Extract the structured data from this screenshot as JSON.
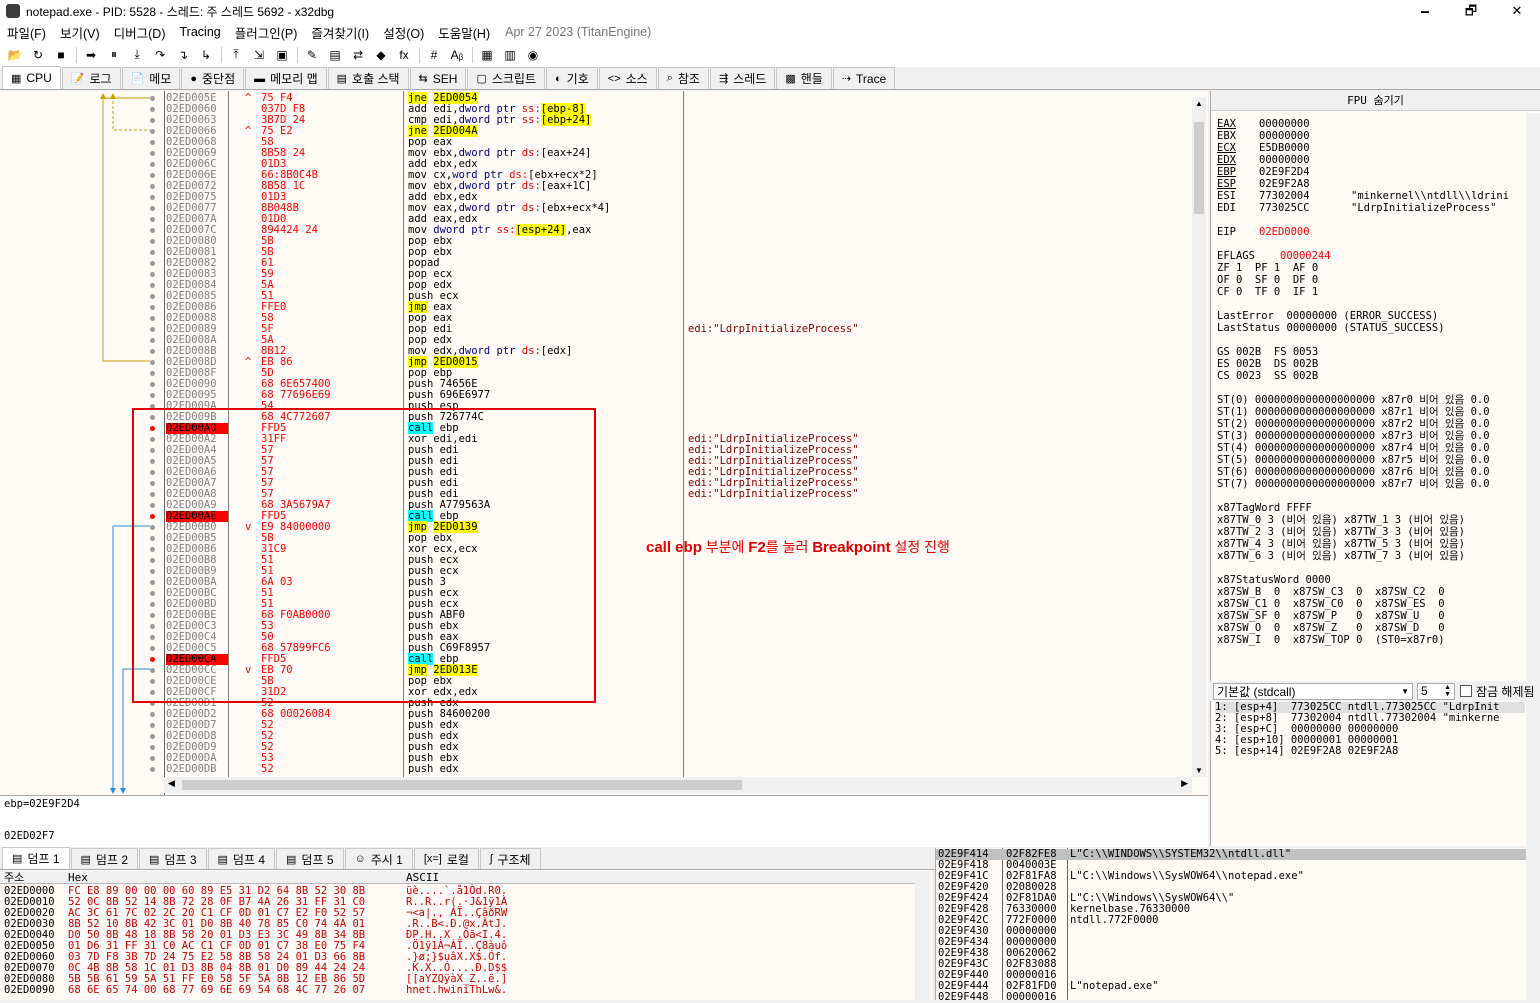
{
  "window": {
    "title": "notepad.exe - PID: 5528 - 스레드: 주 스레드 5692 - x32dbg",
    "minimize": "🗕",
    "maximize": "🗗",
    "close": "✕"
  },
  "menu": {
    "items": [
      "파일(F)",
      "보기(V)",
      "디버그(D)",
      "Tracing",
      "플러그인(P)",
      "즐겨찾기(I)",
      "설정(O)",
      "도움말(H)"
    ],
    "date": "Apr 27 2023 (TitanEngine)"
  },
  "toolbar": {
    "icons": [
      "📂",
      "↻",
      "■",
      "➡",
      "⏸",
      "⤓",
      "↷",
      "↴",
      "↳",
      "⤒",
      "⇲",
      "▣",
      "✎",
      "▤",
      "⇄",
      "◆",
      "fx",
      "#",
      "Aᵦ",
      "▦",
      "▥",
      "◉"
    ]
  },
  "tabs": [
    {
      "icon": "▦",
      "label": "CPU"
    },
    {
      "icon": "📝",
      "label": "로그"
    },
    {
      "icon": "📄",
      "label": "메모"
    },
    {
      "icon": "●",
      "label": "중단점"
    },
    {
      "icon": "▬",
      "label": "메모리 맵"
    },
    {
      "icon": "▤",
      "label": "호출 스택"
    },
    {
      "icon": "⇆",
      "label": "SEH"
    },
    {
      "icon": "▢",
      "label": "스크립트"
    },
    {
      "icon": "◐",
      "label": "기호"
    },
    {
      "icon": "<>",
      "label": "소스"
    },
    {
      "icon": "⌕",
      "label": "참조"
    },
    {
      "icon": "⇶",
      "label": "스레드"
    },
    {
      "icon": "▩",
      "label": "핸들"
    },
    {
      "icon": "⇢",
      "label": "Trace"
    }
  ],
  "disasm": {
    "rows": [
      {
        "a": "02ED005E",
        "j": "^",
        "b": "75 F4",
        "i": [
          {
            "t": "jne",
            "c": "hl-y"
          },
          {
            "t": " "
          },
          {
            "t": "2ED0054",
            "c": "hl-y"
          }
        ]
      },
      {
        "a": "02ED0060",
        "b": "037D F8",
        "i": [
          {
            "t": "add edi,"
          },
          {
            "t": "dword ptr ",
            "c": "ptr"
          },
          {
            "t": "ss:",
            "c": "seg"
          },
          {
            "t": "[ebp-8]",
            "c": "hl-y"
          }
        ]
      },
      {
        "a": "02ED0063",
        "b": "3B7D 24",
        "i": [
          {
            "t": "cmp edi,"
          },
          {
            "t": "dword ptr ",
            "c": "ptr"
          },
          {
            "t": "ss:",
            "c": "seg"
          },
          {
            "t": "[ebp+24]",
            "c": "hl-y"
          }
        ]
      },
      {
        "a": "02ED0066",
        "j": "^",
        "b": "75 E2",
        "i": [
          {
            "t": "jne",
            "c": "hl-y"
          },
          {
            "t": " "
          },
          {
            "t": "2ED004A",
            "c": "hl-y"
          }
        ]
      },
      {
        "a": "02ED0068",
        "b": "58",
        "i": [
          {
            "t": "pop eax"
          }
        ]
      },
      {
        "a": "02ED0069",
        "b": "8B58 24",
        "i": [
          {
            "t": "mov ebx,"
          },
          {
            "t": "dword ptr ",
            "c": "ptr"
          },
          {
            "t": "ds:",
            "c": "seg"
          },
          {
            "t": "[eax+24]"
          }
        ]
      },
      {
        "a": "02ED006C",
        "b": "01D3",
        "i": [
          {
            "t": "add ebx,edx"
          }
        ]
      },
      {
        "a": "02ED006E",
        "b": "66:8B0C4B",
        "i": [
          {
            "t": "mov cx,"
          },
          {
            "t": "word ptr ",
            "c": "ptr"
          },
          {
            "t": "ds:",
            "c": "seg"
          },
          {
            "t": "[ebx+ecx*2]"
          }
        ]
      },
      {
        "a": "02ED0072",
        "b": "8B58 1C",
        "i": [
          {
            "t": "mov ebx,"
          },
          {
            "t": "dword ptr ",
            "c": "ptr"
          },
          {
            "t": "ds:",
            "c": "seg"
          },
          {
            "t": "[eax+1C]"
          }
        ]
      },
      {
        "a": "02ED0075",
        "b": "01D3",
        "i": [
          {
            "t": "add ebx,edx"
          }
        ]
      },
      {
        "a": "02ED0077",
        "b": "8B048B",
        "i": [
          {
            "t": "mov eax,"
          },
          {
            "t": "dword ptr ",
            "c": "ptr"
          },
          {
            "t": "ds:",
            "c": "seg"
          },
          {
            "t": "[ebx+ecx*4]"
          }
        ]
      },
      {
        "a": "02ED007A",
        "b": "01D0",
        "i": [
          {
            "t": "add eax,edx"
          }
        ]
      },
      {
        "a": "02ED007C",
        "b": "894424 24",
        "i": [
          {
            "t": "mov "
          },
          {
            "t": "dword ptr ",
            "c": "ptr"
          },
          {
            "t": "ss:",
            "c": "seg"
          },
          {
            "t": "[esp+24]",
            "c": "hl-y"
          },
          {
            "t": ",eax"
          }
        ]
      },
      {
        "a": "02ED0080",
        "b": "5B",
        "i": [
          {
            "t": "pop ebx"
          }
        ]
      },
      {
        "a": "02ED0081",
        "b": "5B",
        "i": [
          {
            "t": "pop ebx"
          }
        ]
      },
      {
        "a": "02ED0082",
        "b": "61",
        "i": [
          {
            "t": "popad"
          }
        ]
      },
      {
        "a": "02ED0083",
        "b": "59",
        "i": [
          {
            "t": "pop ecx"
          }
        ]
      },
      {
        "a": "02ED0084",
        "b": "5A",
        "i": [
          {
            "t": "pop edx"
          }
        ]
      },
      {
        "a": "02ED0085",
        "b": "51",
        "i": [
          {
            "t": "push ecx"
          }
        ]
      },
      {
        "a": "02ED0086",
        "b": "FFE0",
        "i": [
          {
            "t": "jmp",
            "c": "hl-y"
          },
          {
            "t": " eax"
          }
        ]
      },
      {
        "a": "02ED0088",
        "b": "58",
        "i": [
          {
            "t": "pop eax"
          }
        ]
      },
      {
        "a": "02ED0089",
        "b": "5F",
        "i": [
          {
            "t": "pop edi"
          }
        ],
        "c": "edi:\"LdrpInitializeProcess\""
      },
      {
        "a": "02ED008A",
        "b": "5A",
        "i": [
          {
            "t": "pop edx"
          }
        ]
      },
      {
        "a": "02ED008B",
        "b": "8B12",
        "i": [
          {
            "t": "mov edx,"
          },
          {
            "t": "dword ptr ",
            "c": "ptr"
          },
          {
            "t": "ds:",
            "c": "seg"
          },
          {
            "t": "[edx]"
          }
        ]
      },
      {
        "a": "02ED008D",
        "j": "^",
        "b": "EB 86",
        "i": [
          {
            "t": "jmp",
            "c": "hl-y"
          },
          {
            "t": " "
          },
          {
            "t": "2ED0015",
            "c": "hl-y"
          }
        ]
      },
      {
        "a": "02ED008F",
        "b": "5D",
        "i": [
          {
            "t": "pop ebp"
          }
        ]
      },
      {
        "a": "02ED0090",
        "b": "68 6E657400",
        "i": [
          {
            "t": "push 74656E"
          }
        ]
      },
      {
        "a": "02ED0095",
        "b": "68 77696E69",
        "i": [
          {
            "t": "push 696E6977"
          }
        ]
      },
      {
        "a": "02ED009A",
        "b": "54",
        "i": [
          {
            "t": "push esp"
          }
        ]
      },
      {
        "a": "02ED009B",
        "b": "68 4C772607",
        "i": [
          {
            "t": "push 726774C"
          }
        ]
      },
      {
        "a": "02ED00A0",
        "bp": true,
        "b": "FFD5",
        "i": [
          {
            "t": "call",
            "c": "hl-c"
          },
          {
            "t": " ebp"
          }
        ]
      },
      {
        "a": "02ED00A2",
        "b": "31FF",
        "i": [
          {
            "t": "xor edi,edi"
          }
        ],
        "c": "edi:\"LdrpInitializeProcess\""
      },
      {
        "a": "02ED00A4",
        "b": "57",
        "i": [
          {
            "t": "push edi"
          }
        ],
        "c": "edi:\"LdrpInitializeProcess\""
      },
      {
        "a": "02ED00A5",
        "b": "57",
        "i": [
          {
            "t": "push edi"
          }
        ],
        "c": "edi:\"LdrpInitializeProcess\""
      },
      {
        "a": "02ED00A6",
        "b": "57",
        "i": [
          {
            "t": "push edi"
          }
        ],
        "c": "edi:\"LdrpInitializeProcess\""
      },
      {
        "a": "02ED00A7",
        "b": "57",
        "i": [
          {
            "t": "push edi"
          }
        ],
        "c": "edi:\"LdrpInitializeProcess\""
      },
      {
        "a": "02ED00A8",
        "b": "57",
        "i": [
          {
            "t": "push edi"
          }
        ],
        "c": "edi:\"LdrpInitializeProcess\""
      },
      {
        "a": "02ED00A9",
        "b": "68 3A5679A7",
        "i": [
          {
            "t": "push A779563A"
          }
        ]
      },
      {
        "a": "02ED00AE",
        "bp": true,
        "b": "FFD5",
        "i": [
          {
            "t": "call",
            "c": "hl-c"
          },
          {
            "t": " ebp"
          }
        ]
      },
      {
        "a": "02ED00B0",
        "j": "v",
        "b": "E9 84000000",
        "i": [
          {
            "t": "jmp",
            "c": "hl-y"
          },
          {
            "t": " "
          },
          {
            "t": "2ED0139",
            "c": "hl-y"
          }
        ]
      },
      {
        "a": "02ED00B5",
        "b": "5B",
        "i": [
          {
            "t": "pop ebx"
          }
        ]
      },
      {
        "a": "02ED00B6",
        "b": "31C9",
        "i": [
          {
            "t": "xor ecx,ecx"
          }
        ]
      },
      {
        "a": "02ED00B8",
        "b": "51",
        "i": [
          {
            "t": "push ecx"
          }
        ]
      },
      {
        "a": "02ED00B9",
        "b": "51",
        "i": [
          {
            "t": "push ecx"
          }
        ]
      },
      {
        "a": "02ED00BA",
        "b": "6A 03",
        "i": [
          {
            "t": "push 3"
          }
        ]
      },
      {
        "a": "02ED00BC",
        "b": "51",
        "i": [
          {
            "t": "push ecx"
          }
        ]
      },
      {
        "a": "02ED00BD",
        "b": "51",
        "i": [
          {
            "t": "push ecx"
          }
        ]
      },
      {
        "a": "02ED00BE",
        "b": "68 F0AB0000",
        "i": [
          {
            "t": "push ABF0"
          }
        ]
      },
      {
        "a": "02ED00C3",
        "b": "53",
        "i": [
          {
            "t": "push ebx"
          }
        ]
      },
      {
        "a": "02ED00C4",
        "b": "50",
        "i": [
          {
            "t": "push eax"
          }
        ]
      },
      {
        "a": "02ED00C5",
        "b": "68 57899FC6",
        "i": [
          {
            "t": "push C69F8957"
          }
        ]
      },
      {
        "a": "02ED00CA",
        "bp": true,
        "b": "FFD5",
        "i": [
          {
            "t": "call",
            "c": "hl-c"
          },
          {
            "t": " ebp"
          }
        ]
      },
      {
        "a": "02ED00CC",
        "j": "v",
        "b": "EB 70",
        "i": [
          {
            "t": "jmp",
            "c": "hl-y"
          },
          {
            "t": " "
          },
          {
            "t": "2ED013E",
            "c": "hl-y"
          }
        ]
      },
      {
        "a": "02ED00CE",
        "b": "5B",
        "i": [
          {
            "t": "pop ebx"
          }
        ]
      },
      {
        "a": "02ED00CF",
        "b": "31D2",
        "i": [
          {
            "t": "xor edx,edx"
          }
        ]
      },
      {
        "a": "02ED00D1",
        "b": "52",
        "i": [
          {
            "t": "push edx"
          }
        ]
      },
      {
        "a": "02ED00D2",
        "b": "68 00026084",
        "i": [
          {
            "t": "push 84600200"
          }
        ]
      },
      {
        "a": "02ED00D7",
        "b": "52",
        "i": [
          {
            "t": "push edx"
          }
        ]
      },
      {
        "a": "02ED00D8",
        "b": "52",
        "i": [
          {
            "t": "push edx"
          }
        ]
      },
      {
        "a": "02ED00D9",
        "b": "52",
        "i": [
          {
            "t": "push edx"
          }
        ]
      },
      {
        "a": "02ED00DA",
        "b": "53",
        "i": [
          {
            "t": "push ebx"
          }
        ]
      },
      {
        "a": "02ED00DB",
        "b": "52",
        "i": [
          {
            "t": "push edx"
          }
        ]
      }
    ],
    "annotation_bold": "call ebp",
    "annotation_mid": " 부분에 ",
    "annotation_bold2": "F2",
    "annotation_mid2": "를 눌러 ",
    "annotation_bold3": "Breakpoint",
    "annotation_tail": " 설정 진행"
  },
  "info": {
    "line1": "ebp=02E9F2D4",
    "line2": "02ED02F7"
  },
  "fpu": {
    "header": "FPU 숨기기",
    "regs": [
      {
        "n": "EAX",
        "v": "00000000",
        "u": true
      },
      {
        "n": "EBX",
        "v": "00000000"
      },
      {
        "n": "ECX",
        "v": "E5DB0000",
        "u": true
      },
      {
        "n": "EDX",
        "v": "00000000",
        "u": true
      },
      {
        "n": "EBP",
        "v": "02E9F2D4",
        "u": true
      },
      {
        "n": "ESP",
        "v": "02E9F2A8",
        "u": true
      },
      {
        "n": "ESI",
        "v": "77302004",
        "c": "\"minkernel\\\\ntdll\\\\ldrini"
      },
      {
        "n": "EDI",
        "v": "773025CC",
        "c": "\"LdrpInitializeProcess\""
      }
    ],
    "eip": {
      "n": "EIP",
      "v": "02ED0000"
    },
    "eflags": {
      "n": "EFLAGS",
      "v": "00000244"
    },
    "flags": [
      "ZF 1  PF 1  AF 0",
      "OF 0  SF 0  DF 0",
      "CF 0  TF 0  IF 1"
    ],
    "lasterror": "LastError  00000000 (ERROR_SUCCESS)",
    "laststatus": "LastStatus 00000000 (STATUS_SUCCESS)",
    "segs": [
      "GS 002B  FS 0053",
      "ES 002B  DS 002B",
      "CS 0023  SS 002B"
    ],
    "st": [
      "ST(0) 0000000000000000000 x87r0 비어 있음 0.0",
      "ST(1) 0000000000000000000 x87r1 비어 있음 0.0",
      "ST(2) 0000000000000000000 x87r2 비어 있음 0.0",
      "ST(3) 0000000000000000000 x87r3 비어 있음 0.0",
      "ST(4) 0000000000000000000 x87r4 비어 있음 0.0",
      "ST(5) 0000000000000000000 x87r5 비어 있음 0.0",
      "ST(6) 0000000000000000000 x87r6 비어 있음 0.0",
      "ST(7) 0000000000000000000 x87r7 비어 있음 0.0"
    ],
    "tag": [
      "x87TagWord FFFF",
      "x87TW_0 3 (비어 있음) x87TW_1 3 (비어 있음)",
      "x87TW_2 3 (비어 있음) x87TW_3 3 (비어 있음)",
      "x87TW_4 3 (비어 있음) x87TW_5 3 (비어 있음)",
      "x87TW_6 3 (비어 있음) x87TW_7 3 (비어 있음)"
    ],
    "status": [
      "x87StatusWord 0000",
      "x87SW_B  0  x87SW_C3  0  x87SW_C2  0",
      "x87SW_C1 0  x87SW_C0  0  x87SW_ES  0",
      "x87SW_SF 0  x87SW_P   0  x87SW_U   0",
      "x87SW_O  0  x87SW_Z   0  x87SW_D   0",
      "x87SW_I  0  x87SW_TOP 0  (ST0=x87r0)"
    ]
  },
  "callconv": {
    "select": "기본값 (stdcall)",
    "count": "5",
    "lock": "잠금 해제됨"
  },
  "args": [
    "1: [esp+4]  773025CC ntdll.773025CC \"LdrpInit",
    "2: [esp+8]  77302004 ntdll.77302004 \"minkerne",
    "3: [esp+C]  00000000 00000000",
    "4: [esp+10] 00000001 00000001",
    "5: [esp+14] 02E9F2A8 02E9F2A8"
  ],
  "bottom_tabs": [
    {
      "icon": "▤",
      "label": "덤프 1"
    },
    {
      "icon": "▤",
      "label": "덤프 2"
    },
    {
      "icon": "▤",
      "label": "덤프 3"
    },
    {
      "icon": "▤",
      "label": "덤프 4"
    },
    {
      "icon": "▤",
      "label": "덤프 5"
    },
    {
      "icon": "☺",
      "label": "주시 1"
    },
    {
      "icon": "[x=]",
      "label": "로컬"
    },
    {
      "icon": "ʃ",
      "label": "구조체"
    }
  ],
  "dump": {
    "headers": {
      "addr": "주소",
      "hex": "Hex",
      "ascii": "ASCII"
    },
    "rows": [
      {
        "a": "02ED0000",
        "h": "FC E8 89 00 00 00 60 89 E5 31 D2 64 8B 52 30 8B",
        "s": "üè....`.å1Òd.R0."
      },
      {
        "a": "02ED0010",
        "h": "52 0C 8B 52 14 8B 72 28 0F B7 4A 26 31 FF 31 C0",
        "s": "R..R..r(.·J&1ÿ1À"
      },
      {
        "a": "02ED0020",
        "h": "AC 3C 61 7C 02 2C 20 C1 CF 0D 01 C7 E2 F0 52 57",
        "s": "¬<a|., ÁÏ..ÇâðRW"
      },
      {
        "a": "02ED0030",
        "h": "8B 52 10 8B 42 3C 01 D0 8B 40 78 85 C0 74 4A 01",
        "s": ".R..B<.Ð.@x.ÀtJ."
      },
      {
        "a": "02ED0040",
        "h": "D0 50 8B 48 18 8B 58 20 01 D3 E3 3C 49 8B 34 8B",
        "s": "ÐP.H..X .Óã<I.4."
      },
      {
        "a": "02ED0050",
        "h": "01 D6 31 FF 31 C0 AC C1 CF 0D 01 C7 38 E0 75 F4",
        "s": ".Ö1ÿ1À¬ÁÏ..Ç8àuô"
      },
      {
        "a": "02ED0060",
        "h": "03 7D F8 3B 7D 24 75 E2 58 8B 58 24 01 D3 66 8B",
        "s": ".}ø;}$uâX.X$.Óf."
      },
      {
        "a": "02ED0070",
        "h": "0C 4B 8B 58 1C 01 D3 8B 04 8B 01 D0 89 44 24 24",
        "s": ".K.X..Ó....Ð.D$$"
      },
      {
        "a": "02ED0080",
        "h": "5B 5B 61 59 5A 51 FF E0 58 5F 5A 8B 12 EB 86 5D",
        "s": "[[aYZQÿàX_Z..ë.]"
      },
      {
        "a": "02ED0090",
        "h": "68 6E 65 74 00 68 77 69 6E 69 54 68 4C 77 26 07",
        "s": "hnet.hwiniThLw&."
      }
    ]
  },
  "stack": {
    "rows": [
      {
        "a": "02E9F414",
        "v": "02F82FE8",
        "c": "L\"C:\\\\WINDOWS\\\\SYSTEM32\\\\ntdll.dll\"",
        "sel": true
      },
      {
        "a": "02E9F418",
        "v": "0040003E",
        "c": ""
      },
      {
        "a": "02E9F41C",
        "v": "02F81FA8",
        "c": "L\"C:\\\\Windows\\\\SysWOW64\\\\notepad.exe\""
      },
      {
        "a": "02E9F420",
        "v": "02080028",
        "c": ""
      },
      {
        "a": "02E9F424",
        "v": "02F81DA0",
        "c": "L\"C:\\\\Windows\\\\SysWOW64\\\\\""
      },
      {
        "a": "02E9F428",
        "v": "76330000",
        "c": "kernelbase.76330000"
      },
      {
        "a": "02E9F42C",
        "v": "772F0000",
        "c": "ntdll.772F0000"
      },
      {
        "a": "02E9F430",
        "v": "00000000",
        "c": ""
      },
      {
        "a": "02E9F434",
        "v": "00000000",
        "c": ""
      },
      {
        "a": "02E9F438",
        "v": "00620062",
        "c": ""
      },
      {
        "a": "02E9F43C",
        "v": "02F83088",
        "c": ""
      },
      {
        "a": "02E9F440",
        "v": "00000016",
        "c": ""
      },
      {
        "a": "02E9F444",
        "v": "02F81FD0",
        "c": "L\"notepad.exe\""
      },
      {
        "a": "02E9F448",
        "v": "00000016",
        "c": ""
      }
    ]
  }
}
